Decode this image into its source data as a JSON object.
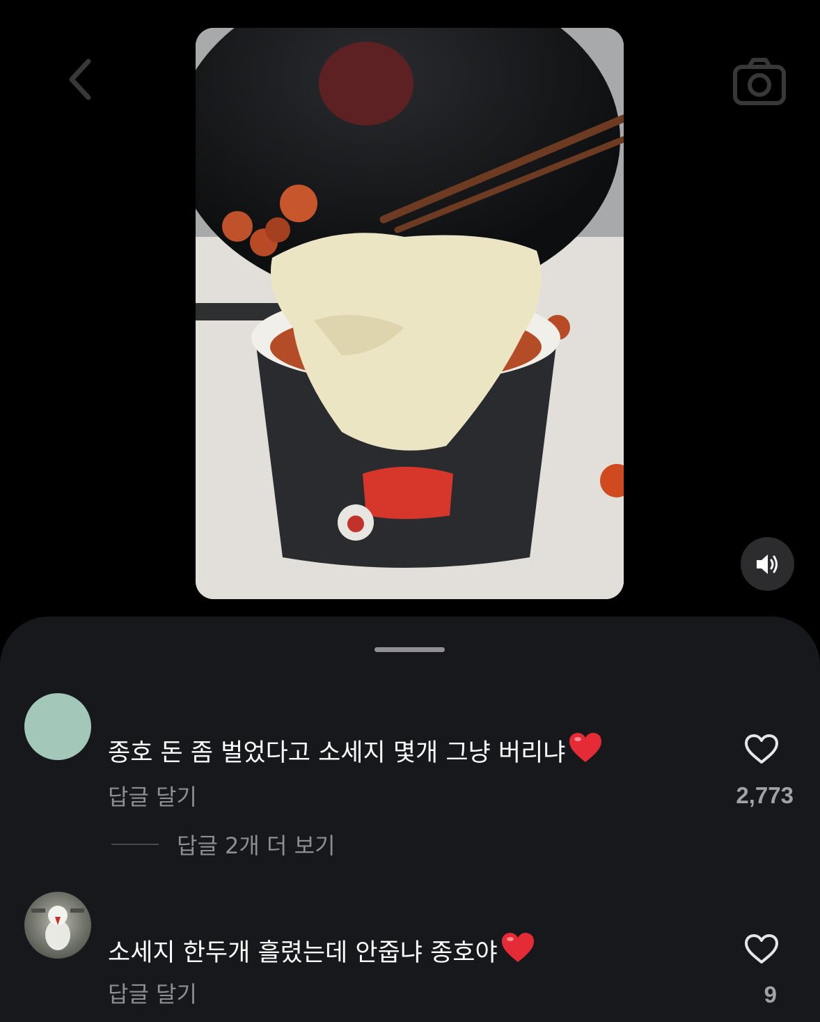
{
  "icons": {
    "back": "chevron-left-icon",
    "camera": "camera-icon",
    "sound": "speaker-icon",
    "like": "heart-outline-icon",
    "emoji": "red-heart-emoji"
  },
  "colors": {
    "sheet_background": "#16181c",
    "secondary_text": "#8e8e93",
    "heart_red": "#e52b35"
  },
  "comments": [
    {
      "text": "종호 돈 좀 벌었다고 소세지 몇개 그냥 버리냐",
      "reply_label": "답글 달기",
      "likes": "2,773",
      "view_replies": "답글 2개 더 보기"
    },
    {
      "text": "소세지 한두개 흘렸는데 안줍냐 종호야",
      "reply_label": "답글 달기",
      "likes": "9"
    }
  ]
}
